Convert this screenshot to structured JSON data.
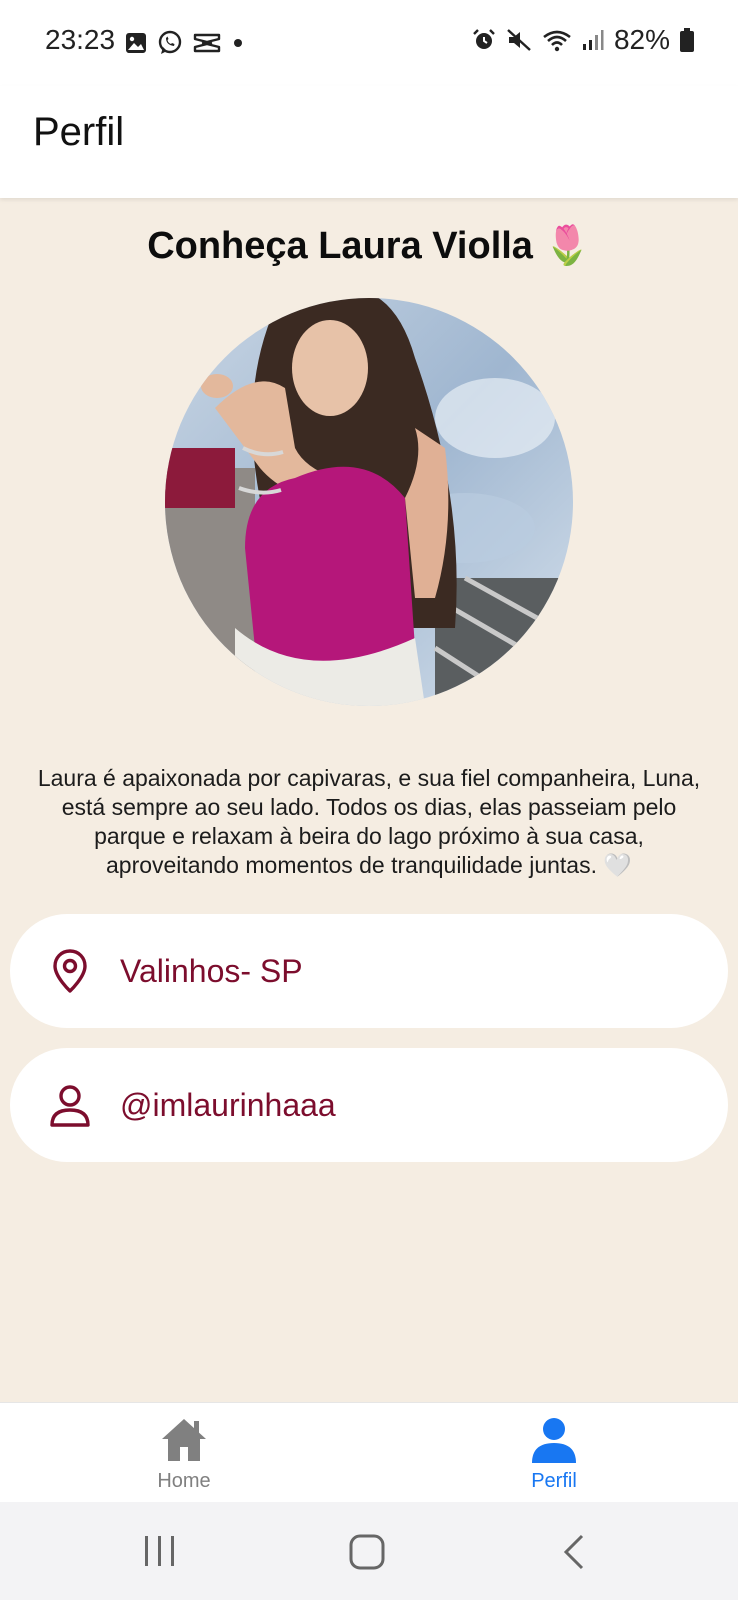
{
  "status_bar": {
    "time": "23:23",
    "battery": "82%",
    "left_icons": [
      "gallery-icon",
      "whatsapp-icon",
      "capcut-icon",
      "dot-icon"
    ],
    "right_icons": [
      "alarm-icon",
      "mute-icon",
      "wifi-icon",
      "signal-icon",
      "battery-icon"
    ]
  },
  "header": {
    "title": "Perfil"
  },
  "profile": {
    "heading": "Conheça Laura Violla 🌷",
    "bio": "Laura é apaixonada por capivaras, e sua fiel companheira, Luna, está sempre ao seu lado. Todos os dias, elas passeiam pelo parque e relaxam à beira do lago próximo à sua casa, aproveitando momentos de tranquilidade juntas. 🤍",
    "location": "Valinhos- SP",
    "username": "@imlaurinhaaa"
  },
  "bottom_nav": {
    "items": [
      {
        "label": "Home",
        "icon": "home-icon",
        "active": false
      },
      {
        "label": "Perfil",
        "icon": "person-icon",
        "active": true
      }
    ]
  },
  "colors": {
    "background": "#f5ede2",
    "accent_text": "#7c0d2d",
    "active_nav": "#1877f2",
    "inactive_nav": "#808080"
  }
}
